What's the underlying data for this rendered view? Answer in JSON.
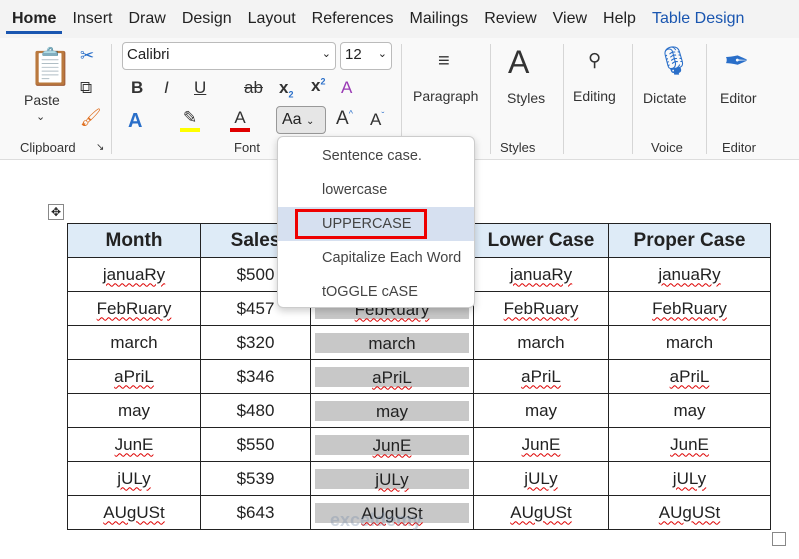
{
  "tabs": [
    "Home",
    "Insert",
    "Draw",
    "Design",
    "Layout",
    "References",
    "Mailings",
    "Review",
    "View",
    "Help",
    "Table Design"
  ],
  "ribbon": {
    "clipboard": {
      "paste": "Paste",
      "label": "Clipboard"
    },
    "font": {
      "name": "Calibri",
      "size": "12",
      "label": "Font",
      "change_case": "Aa"
    },
    "paragraph": "Paragraph",
    "styles": {
      "button": "Styles",
      "label": "Styles"
    },
    "editing": "Editing",
    "voice": {
      "button": "Dictate",
      "label": "Voice"
    },
    "editor": {
      "button": "Editor",
      "label": "Editor"
    }
  },
  "case_menu": {
    "items": [
      "Sentence case.",
      "lowercase",
      "UPPERCASE",
      "Capitalize Each Word",
      "tOGGLE cASE"
    ],
    "highlighted": "UPPERCASE"
  },
  "table": {
    "headers": [
      "Month",
      "Sales",
      "",
      "Lower Case",
      "Proper Case"
    ],
    "rows": [
      [
        "januaRy",
        "$500",
        "",
        "januaRy",
        "januaRy"
      ],
      [
        "FebRuary",
        "$457",
        "FebRuary",
        "FebRuary",
        "FebRuary"
      ],
      [
        "march",
        "$320",
        "march",
        "march",
        "march"
      ],
      [
        "aPriL",
        "$346",
        "aPriL",
        "aPriL",
        "aPriL"
      ],
      [
        "may",
        "$480",
        "may",
        "may",
        "may"
      ],
      [
        "JunE",
        "$550",
        "JunE",
        "JunE",
        "JunE"
      ],
      [
        "jULy",
        "$539",
        "jULy",
        "jULy",
        "jULy"
      ],
      [
        "AUgUSt",
        "$643",
        "AUgUSt",
        "AUgUSt",
        "AUgUSt"
      ]
    ]
  },
  "watermark": "exceldemy",
  "colors": {
    "accent": "#1a56b0",
    "highlight": "#ffff00",
    "font_color": "#e00000",
    "header_fill": "#deebf7"
  }
}
